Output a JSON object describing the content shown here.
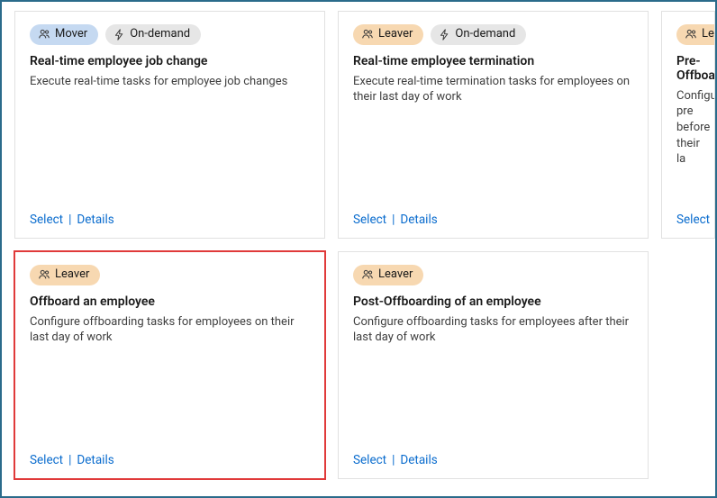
{
  "tagLabels": {
    "mover": "Mover",
    "leaver": "Leaver",
    "ondemand": "On-demand"
  },
  "actions": {
    "select": "Select",
    "details": "Details"
  },
  "cards": [
    {
      "id": "job-change",
      "tags": [
        "mover",
        "ondemand"
      ],
      "title": "Real-time employee job change",
      "desc": "Execute real-time tasks for employee job changes",
      "highlighted": false,
      "clipped": false
    },
    {
      "id": "termination",
      "tags": [
        "leaver",
        "ondemand"
      ],
      "title": "Real-time employee termination",
      "desc": "Execute real-time termination tasks for employees on their last day of work",
      "highlighted": false,
      "clipped": false
    },
    {
      "id": "pre-offboard",
      "tags": [
        "leaver"
      ],
      "title": "Pre-Offboard",
      "desc": "Configure pre before their la",
      "highlighted": false,
      "clipped": true
    },
    {
      "id": "offboard",
      "tags": [
        "leaver"
      ],
      "title": "Offboard an employee",
      "desc": "Configure offboarding tasks for employees on their last day of work",
      "highlighted": true,
      "clipped": false
    },
    {
      "id": "post-offboard",
      "tags": [
        "leaver"
      ],
      "title": "Post-Offboarding of an employee",
      "desc": "Configure offboarding tasks for employees after their last day of work",
      "highlighted": false,
      "clipped": false
    }
  ]
}
